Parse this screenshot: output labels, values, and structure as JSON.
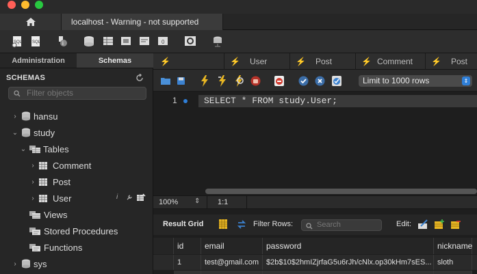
{
  "window": {
    "tab_title": "localhost - Warning - not supported",
    "traffic_lights": [
      "#ff5f57",
      "#febc2e",
      "#28c840"
    ]
  },
  "sidebar": {
    "tabs": [
      "Administration",
      "Schemas"
    ],
    "active_tab": "Schemas",
    "header": "SCHEMAS",
    "filter_placeholder": "Filter objects",
    "tree": [
      {
        "label": "hansu",
        "type": "schema",
        "expanded": false
      },
      {
        "label": "study",
        "type": "schema",
        "expanded": true
      },
      {
        "label": "Tables",
        "type": "folder",
        "expanded": true
      },
      {
        "label": "Comment",
        "type": "table",
        "expanded": false
      },
      {
        "label": "Post",
        "type": "table",
        "expanded": false
      },
      {
        "label": "User",
        "type": "table",
        "expanded": false
      },
      {
        "label": "Views",
        "type": "folder"
      },
      {
        "label": "Stored Procedures",
        "type": "folder"
      },
      {
        "label": "Functions",
        "type": "folder"
      },
      {
        "label": "sys",
        "type": "schema",
        "expanded": false
      }
    ]
  },
  "editor_tabs": [
    "",
    "User",
    "Post",
    "Comment",
    "Post"
  ],
  "editor": {
    "limit_label": "Limit to 1000 rows",
    "line_number": "1",
    "sql": "SELECT * FROM study.User;",
    "zoom": "100%",
    "cursor_pos": "1:1"
  },
  "result": {
    "title": "Result Grid",
    "filter_label": "Filter Rows:",
    "search_placeholder": "Search",
    "edit_label": "Edit:",
    "columns": [
      "id",
      "email",
      "password",
      "nickname"
    ],
    "rows": [
      [
        "1",
        "test@gmail.com",
        "$2b$10$2hmIZjrfaG5u6rJh/cNlx.op30kHm7sES...",
        "sloth"
      ]
    ]
  },
  "colors": {
    "accent_blue": "#2f7fd8",
    "lightning_yellow": "#e8b623"
  }
}
